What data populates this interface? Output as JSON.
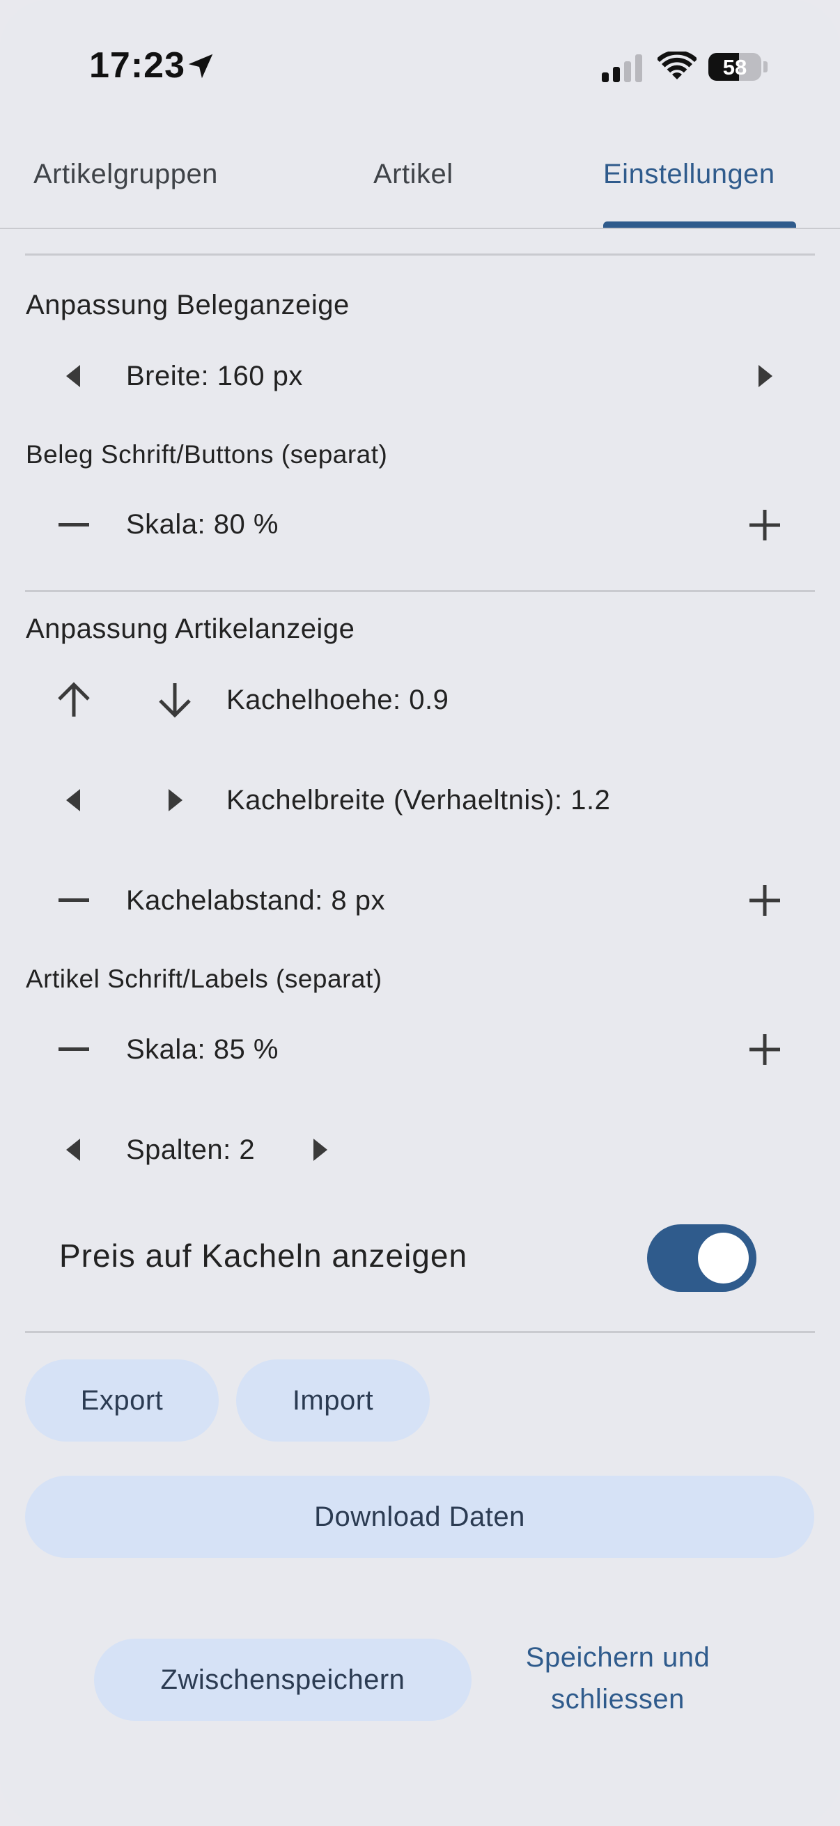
{
  "status_bar": {
    "time": "17:23",
    "battery": "58",
    "icons": [
      "location-arrow-icon",
      "signal-icon",
      "wifi-icon",
      "battery-icon"
    ]
  },
  "tabs": [
    {
      "label": "Artikelgruppen",
      "active": false
    },
    {
      "label": "Artikel",
      "active": false
    },
    {
      "label": "Einstellungen",
      "active": true
    }
  ],
  "beleg": {
    "title": "Anpassung Beleganzeige",
    "width_label": "Breite: 160 px",
    "font_title": "Beleg Schrift/Buttons (separat)",
    "scale_label": "Skala: 80 %"
  },
  "artikel": {
    "title": "Anpassung Artikelanzeige",
    "tile_height_label": "Kachelhoehe: 0.9",
    "tile_width_label": "Kachelbreite (Verhaeltnis): 1.2",
    "tile_spacing_label": "Kachelabstand: 8 px",
    "font_title": "Artikel Schrift/Labels (separat)",
    "scale_label": "Skala: 85 %",
    "columns_label": "Spalten: 2"
  },
  "price_toggle": {
    "label": "Preis auf Kacheln anzeigen",
    "on": true
  },
  "buttons": {
    "export": "Export",
    "import": "Import",
    "download": "Download Daten",
    "save_temp": "Zwischenspeichern",
    "save_close_line1": "Speichern und",
    "save_close_line2": "schliessen"
  },
  "colors": {
    "accent": "#2f5b8c",
    "background": "#e8e9ee",
    "tonal_button": "#d6e2f6",
    "divider": "#c9cacf"
  }
}
